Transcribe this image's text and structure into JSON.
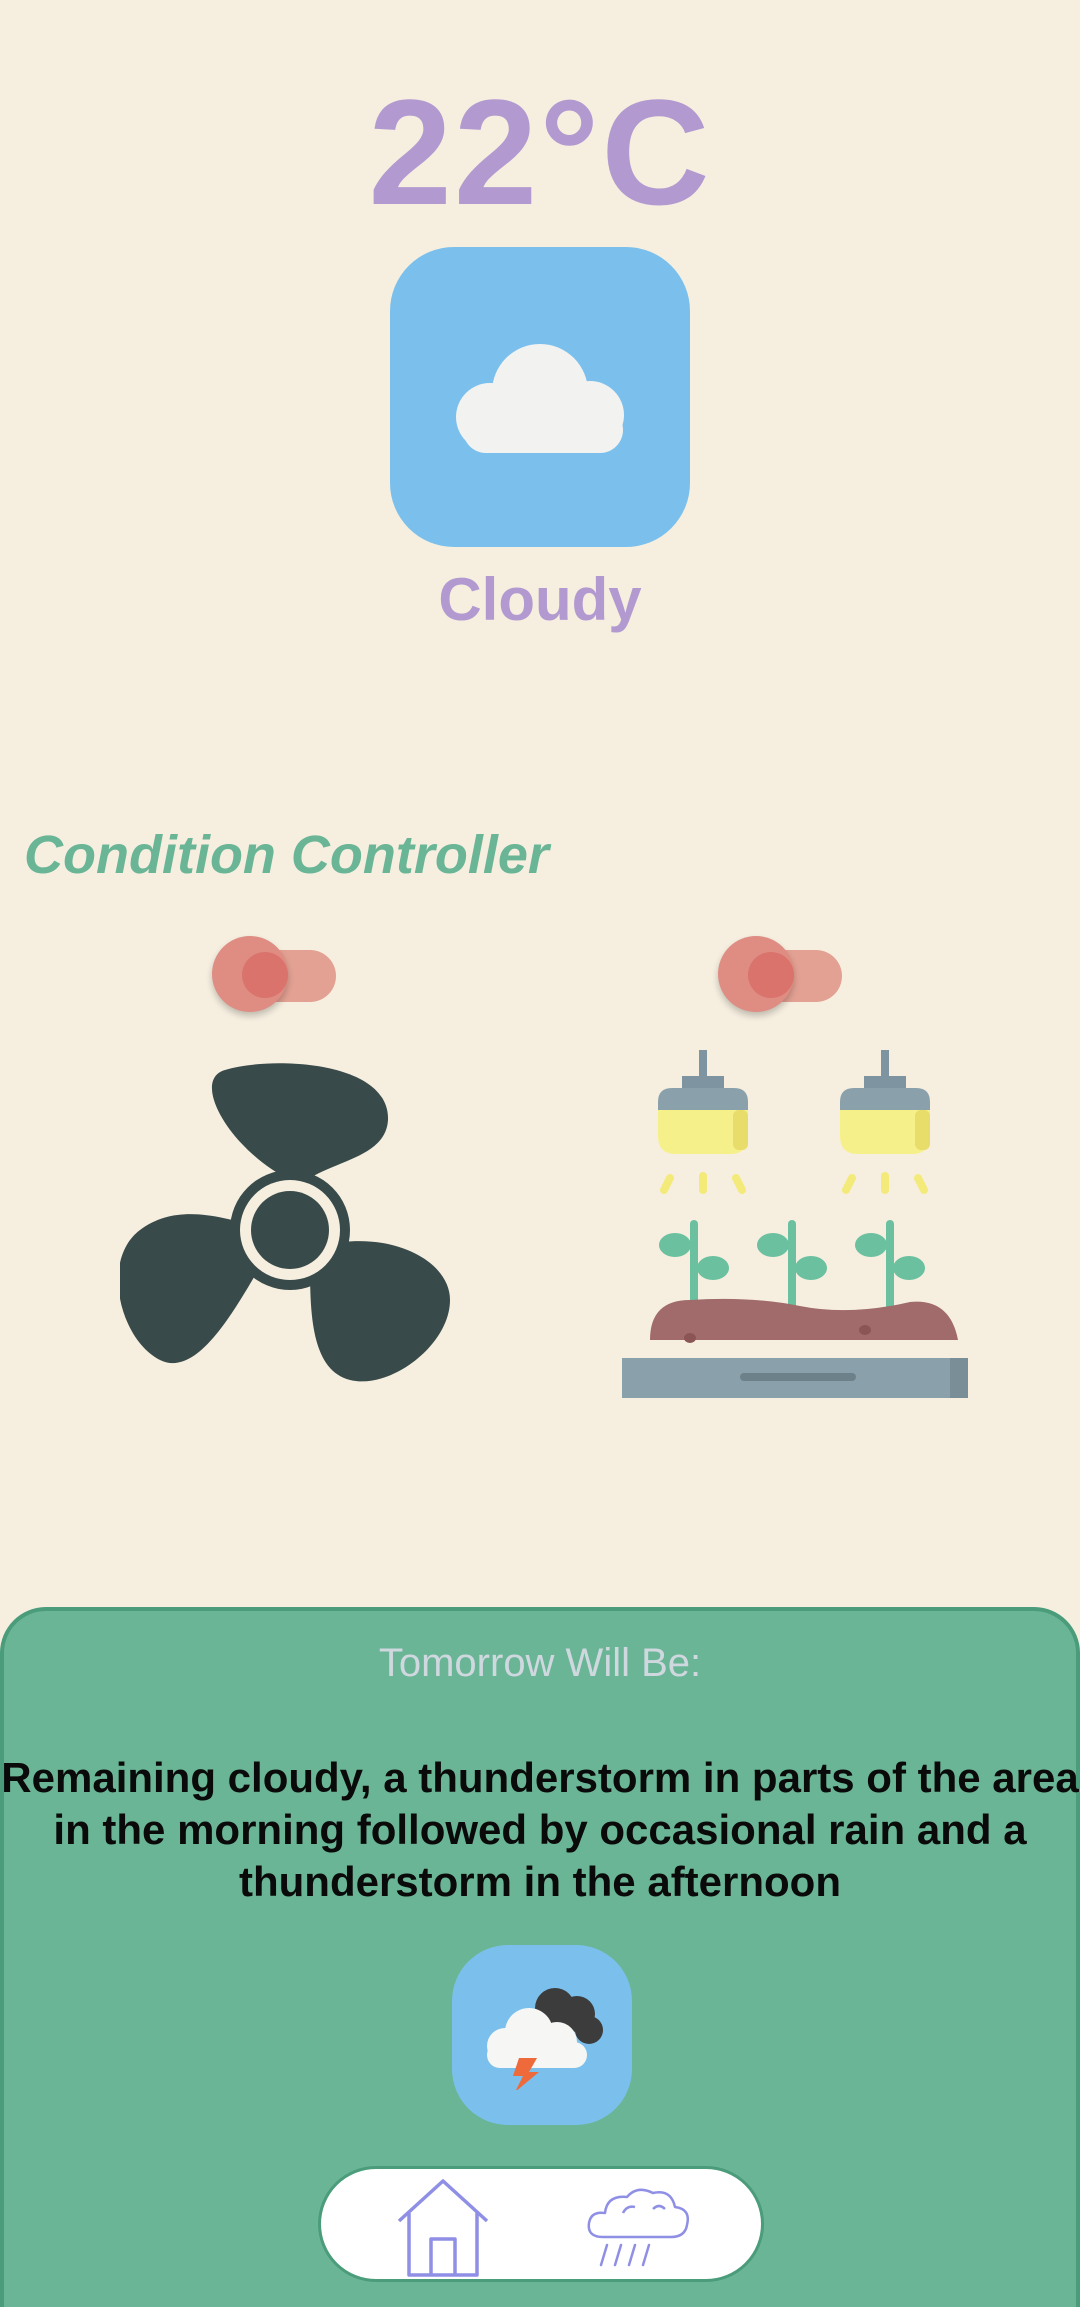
{
  "current": {
    "temperature": "22°C",
    "condition": "Cloudy",
    "icon": "cloud-icon"
  },
  "controller": {
    "title": "Condition Controller",
    "devices": [
      {
        "name": "fan",
        "icon": "fan-icon",
        "toggle_on": false
      },
      {
        "name": "grow-lights",
        "icon": "greenhouse-lights-icon",
        "toggle_on": false
      }
    ]
  },
  "tomorrow": {
    "label": "Tomorrow Will Be:",
    "forecast": "Remaining cloudy, a thunderstorm in parts of the area in the morning followed by occasional rain and a thunderstorm in the afternoon",
    "icon": "thunderstorm-icon"
  },
  "nav": {
    "items": [
      {
        "name": "home",
        "icon": "home-icon"
      },
      {
        "name": "forecast",
        "icon": "rain-cloud-icon"
      }
    ]
  },
  "colors": {
    "background": "#f6efe0",
    "accent_purple": "#b29ad0",
    "accent_green": "#6ab596",
    "tile_blue": "#7bc0ec",
    "toggle_off": "#df8c83"
  }
}
